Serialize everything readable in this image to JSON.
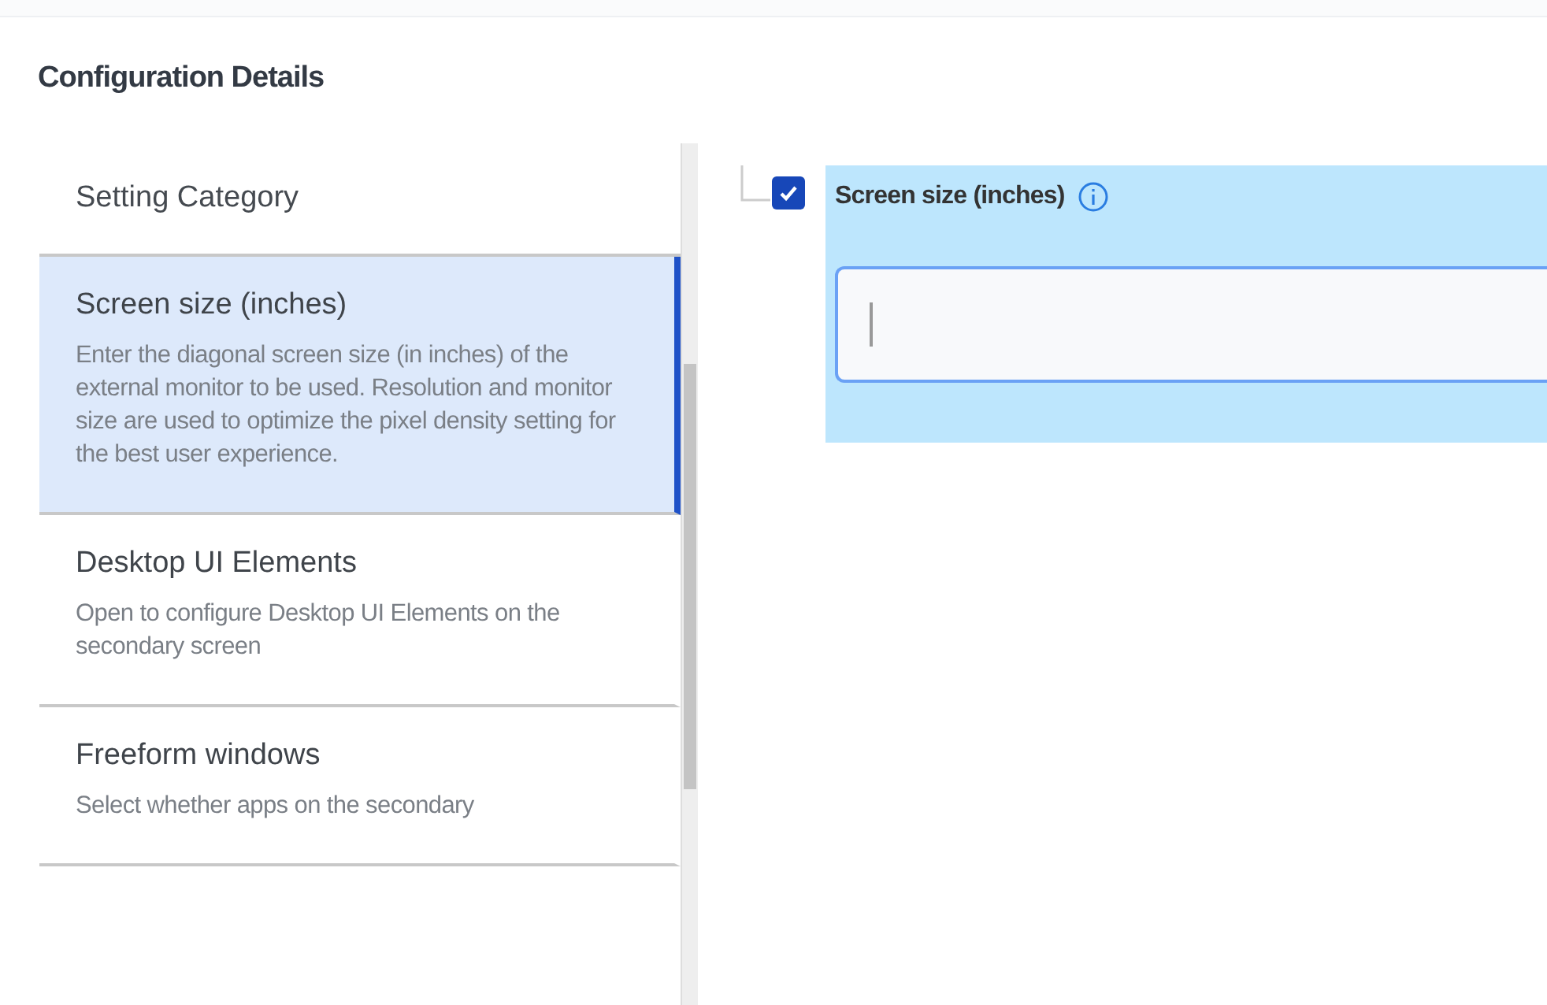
{
  "title": "Configuration Details",
  "category_list": {
    "header": "Setting Category",
    "items": [
      {
        "title": "Screen size (inches)",
        "description": "Enter the diagonal screen size (in inches) of the external monitor to be used. Resolution and monitor size are used to optimize the pixel density setting for the best user experience.",
        "selected": true
      },
      {
        "title": "Desktop UI Elements",
        "description": "Open to configure Desktop UI Elements on the secondary screen",
        "selected": false
      },
      {
        "title": "Freeform windows",
        "description": "Select whether apps on the secondary",
        "selected": false
      }
    ]
  },
  "setting": {
    "label": "Screen size (inches)",
    "checked": true,
    "field": {
      "focused": true
    }
  }
}
